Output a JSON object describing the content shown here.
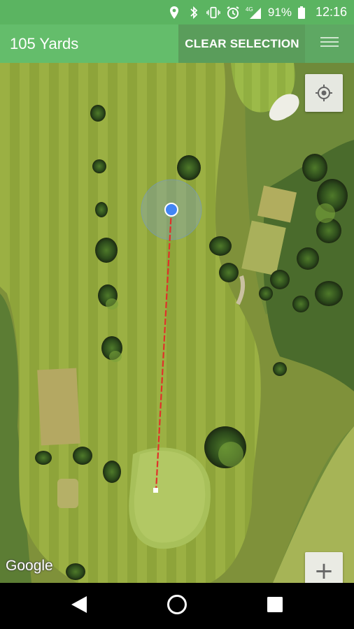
{
  "status_bar": {
    "battery_percent": "91%",
    "time": "12:16",
    "network": "4G",
    "icons": [
      "location-icon",
      "bluetooth-icon",
      "vibrate-icon",
      "alarm-icon",
      "signal-icon",
      "battery-icon"
    ]
  },
  "app_bar": {
    "title": "105 Yards",
    "clear_label": "CLEAR SELECTION",
    "menu_icon": "hamburger-menu-icon"
  },
  "map": {
    "attribution": "Google",
    "zoom_in_label": "+",
    "zoom_out_label": "−",
    "accent_red": "#d32f2f",
    "location_blue": "#4285f4"
  },
  "nav_bar": {
    "icons": [
      "back-icon",
      "home-icon",
      "recents-icon"
    ]
  }
}
